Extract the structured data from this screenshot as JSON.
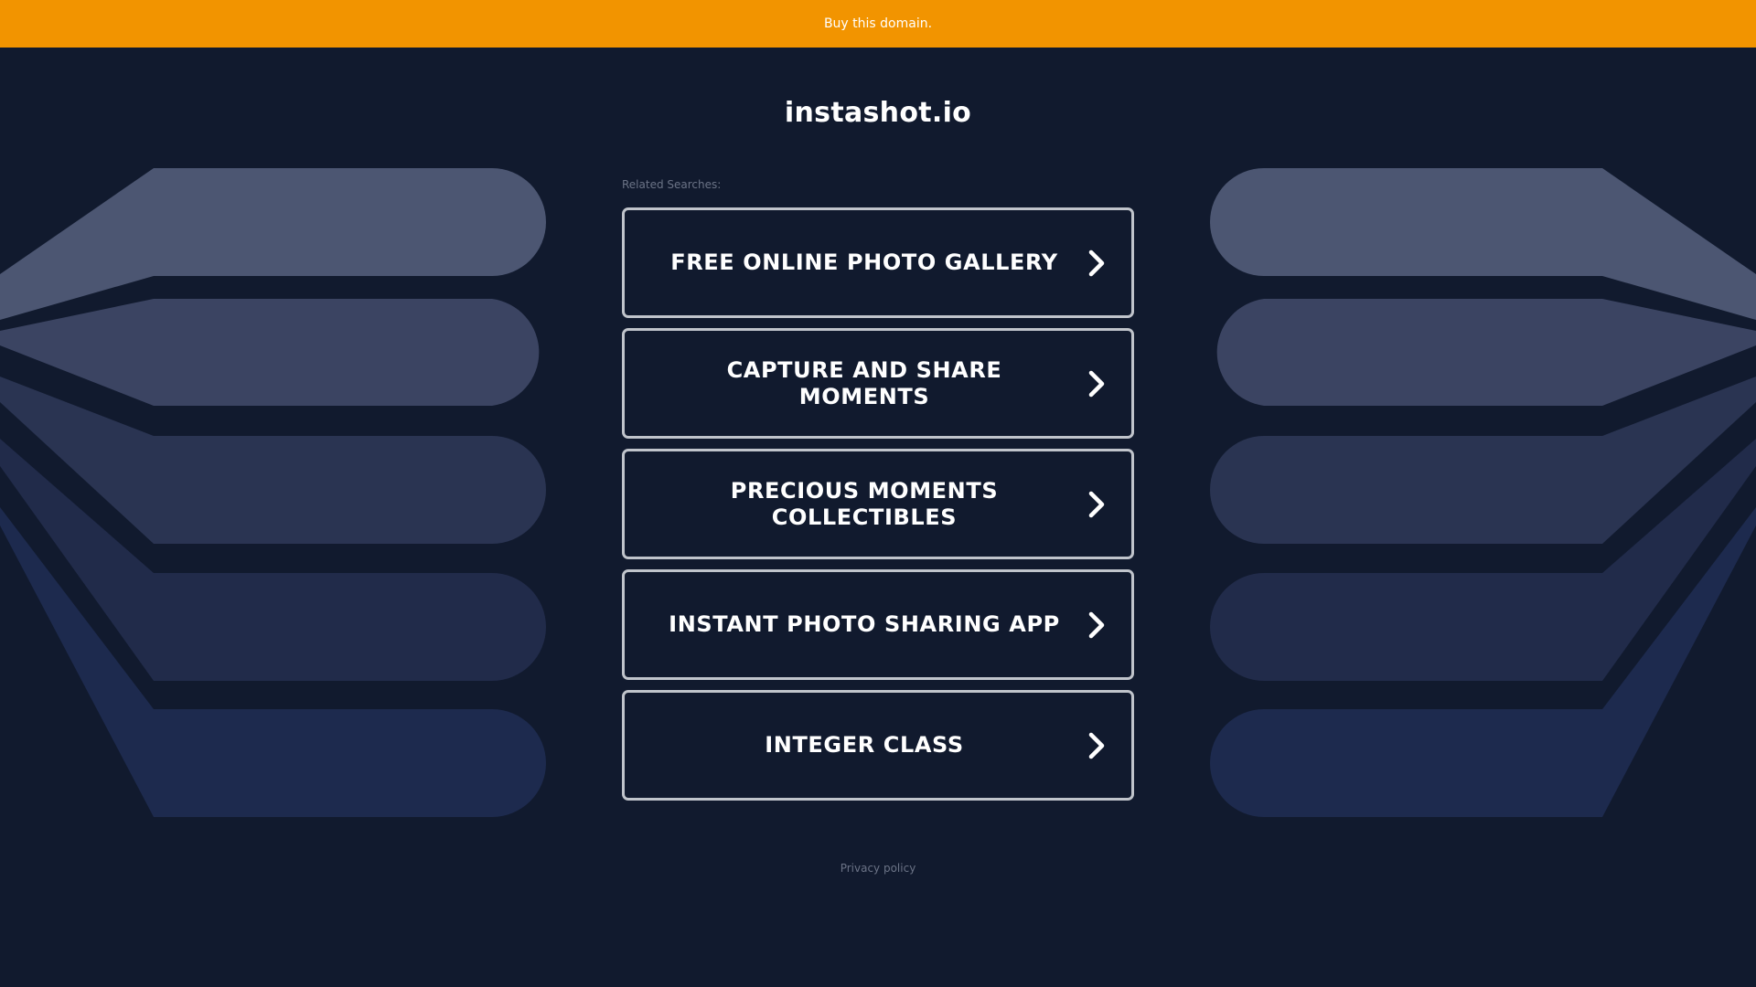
{
  "banner": {
    "label": "Buy this domain."
  },
  "site": {
    "title": "instashot.io"
  },
  "related": {
    "label": "Related Searches:",
    "links": [
      {
        "label": "FREE ONLINE PHOTO GALLERY"
      },
      {
        "label": "CAPTURE AND SHARE MOMENTS"
      },
      {
        "label": "PRECIOUS MOMENTS COLLECTIBLES"
      },
      {
        "label": "INSTANT PHOTO SHARING APP"
      },
      {
        "label": "INTEGER CLASS"
      }
    ]
  },
  "footer": {
    "privacy_label": "Privacy policy"
  },
  "colors": {
    "background": "#111a2e",
    "banner": "#f29400",
    "band_1": "#4c5672",
    "band_2": "#3b4462",
    "band_3": "#2a3452",
    "band_4": "#212b4a",
    "band_5": "#1d2a4e"
  },
  "icons": {
    "link_chevron": "chevron-right-icon"
  }
}
